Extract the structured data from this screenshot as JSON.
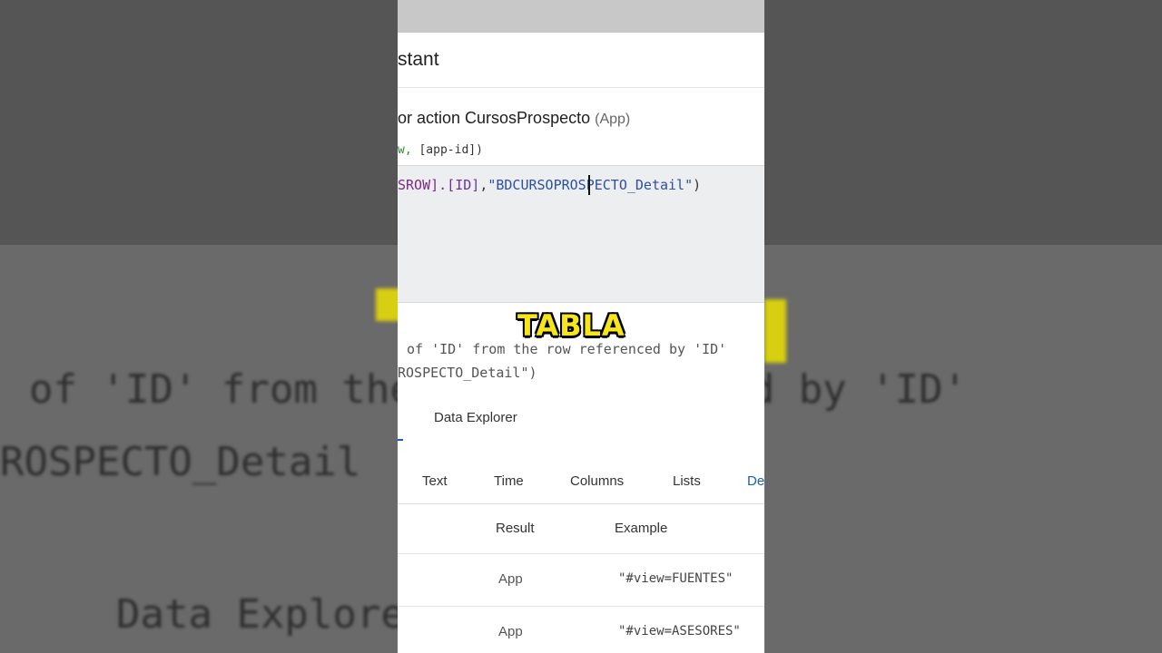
{
  "background": {
    "line1": "of 'ID' from the row referenced by 'ID'",
    "line2": "ROSPECTO_Detail",
    "line3": "Data Explore"
  },
  "dialog": {
    "title_fragment": "stant",
    "action_prefix": "or action CursosProspecto",
    "action_scope": "(App)",
    "args_fragment": "[app-id])",
    "args_green": "w,",
    "code": {
      "part1": "SROW].",
      "part2": "[ID]",
      "part3": ",",
      "part4": "\"BDCURSOPROSPECTO_Detail\"",
      "part5": ")"
    },
    "preview_line1": "of 'ID' from the row referenced by 'ID'",
    "preview_line2": "ROSPECTO_Detail\")"
  },
  "overlay": {
    "word": "TABLA",
    "color": "#f5e51a"
  },
  "explorer": {
    "tab_label": "Data Explorer",
    "category_tabs": [
      "Text",
      "Time",
      "Columns",
      "Lists",
      "De"
    ],
    "table_headers": {
      "result": "Result",
      "example": "Example"
    },
    "rows": [
      {
        "result": "App",
        "example": "\"#view=FUENTES\""
      },
      {
        "result": "App",
        "example": "\"#view=ASESORES\""
      }
    ]
  }
}
